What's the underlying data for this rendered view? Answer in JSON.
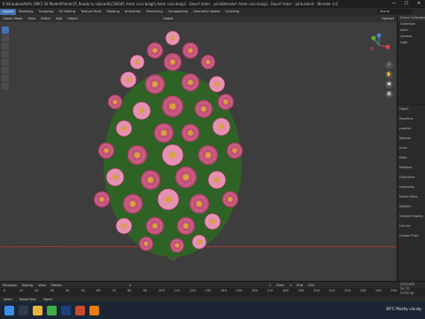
{
  "window": {
    "title": "E:\\Dropbox\\AHA\\ OMCI 3d Model\\Plants\\Zf_Ready to Upload\\LC00045 Aster novi-belgii\\ Aster novi-belgii - Dwarf Aster - pink\\Blender\\ Aster novi-belgii - Dwarf Aster - pink.blend - Blender 4.0",
    "minimize": "—",
    "maximize": "☐",
    "close": "✕"
  },
  "menubar": {
    "items": [
      "Layout",
      "Modeling",
      "Sculpting",
      "UV Editing",
      "Texture Paint",
      "Shading",
      "Animation",
      "Rendering",
      "Compositing",
      "Geometry Nodes",
      "Scripting"
    ],
    "active": "Layout",
    "scene": "Scene"
  },
  "viewport_header": {
    "mode": "Object Mode",
    "items": [
      "View",
      "Select",
      "Add",
      "Object"
    ],
    "orientation": "Global",
    "options": "Options"
  },
  "outliner": {
    "rows": [
      "Scene Collection",
      "Collection",
      "Aster",
      "Camera",
      "Light"
    ]
  },
  "properties": {
    "rows": [
      "Object",
      "Transform",
      "Location",
      "Rotation",
      "Scale",
      "Delta",
      "Relations",
      "Collections",
      "Instancing",
      "Motion Paths",
      "Visibility",
      "Viewport Display",
      "Line Art",
      "Custom Props"
    ]
  },
  "timeline": {
    "controls": [
      "Playback",
      "Keying",
      "View",
      "Marker"
    ],
    "ticks": [
      "0",
      "10",
      "20",
      "30",
      "40",
      "50",
      "60",
      "70",
      "80",
      "90",
      "100",
      "110",
      "120",
      "130",
      "140",
      "150",
      "160",
      "170",
      "180",
      "190",
      "200",
      "210",
      "220",
      "230",
      "240",
      "250"
    ],
    "current_frame": "1",
    "start_label": "Start",
    "start": "1",
    "end_label": "End",
    "end": "250"
  },
  "status": {
    "select": "Select",
    "rotate": "Rotate View",
    "object": "Object"
  },
  "activate_windows": {
    "line1": "Activate",
    "line2": "Go to Settings"
  },
  "taskbar": {
    "weather": "38°C  Mostly cloudy"
  },
  "colors": {
    "accent": "#4772b3",
    "flower_pink": "#c2527a",
    "leaf_green": "#3f7a2f"
  }
}
